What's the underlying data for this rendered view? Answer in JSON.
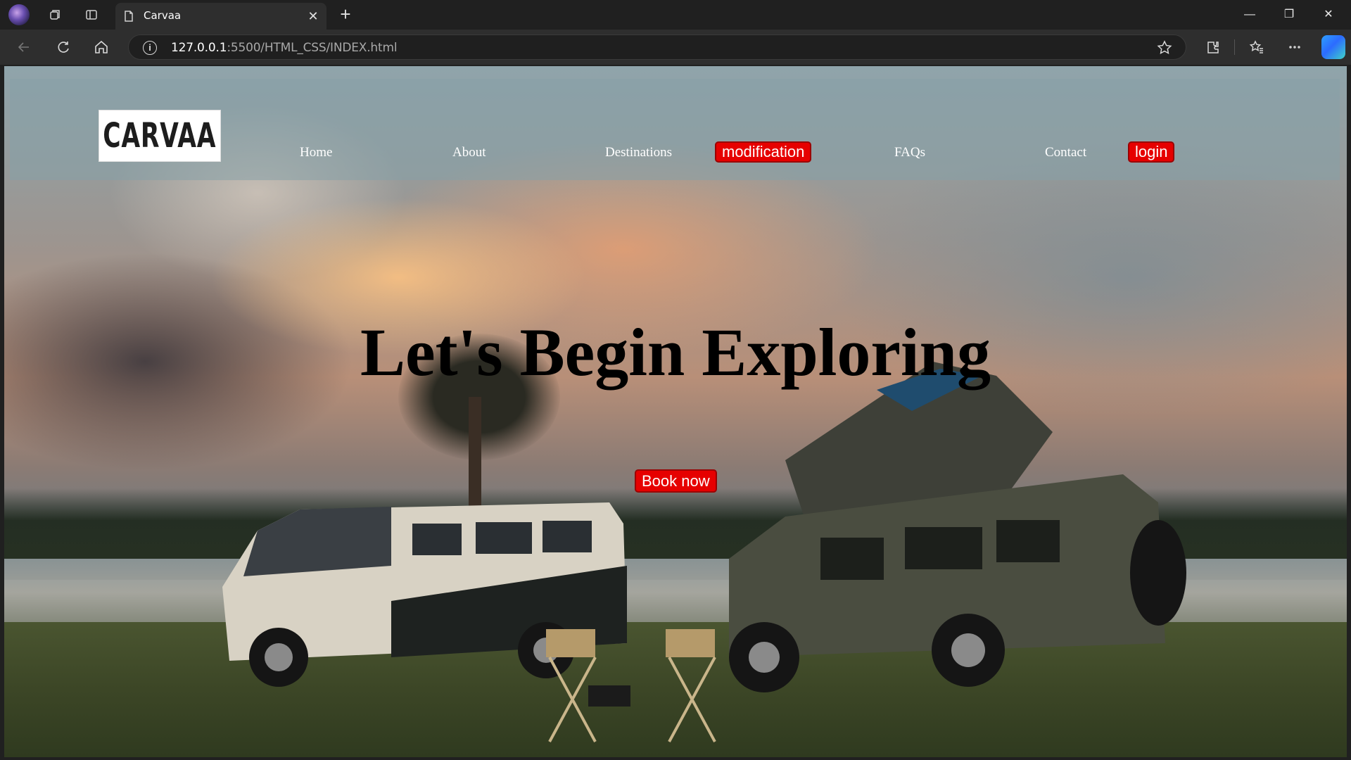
{
  "browser": {
    "tab": {
      "title": "Carvaa"
    },
    "address": {
      "host": "127.0.0.1",
      "path": ":5500/HTML_CSS/INDEX.html"
    },
    "window_controls": {
      "minimize": "—",
      "restore": "❐",
      "close": "✕"
    },
    "tab_close": "✕",
    "new_tab": "+"
  },
  "site": {
    "logo_text": "CARVAA",
    "nav": {
      "home": "Home",
      "about": "About",
      "destinations": "Destinations",
      "modification": "modification",
      "faqs": "FAQs",
      "contact": "Contact",
      "login": "login"
    },
    "hero": {
      "title": "Let's Begin Exploring",
      "book_button": "Book now"
    }
  },
  "colors": {
    "accent_red": "#e60000",
    "nav_overlay": "rgba(135,160,168,0.55)"
  }
}
